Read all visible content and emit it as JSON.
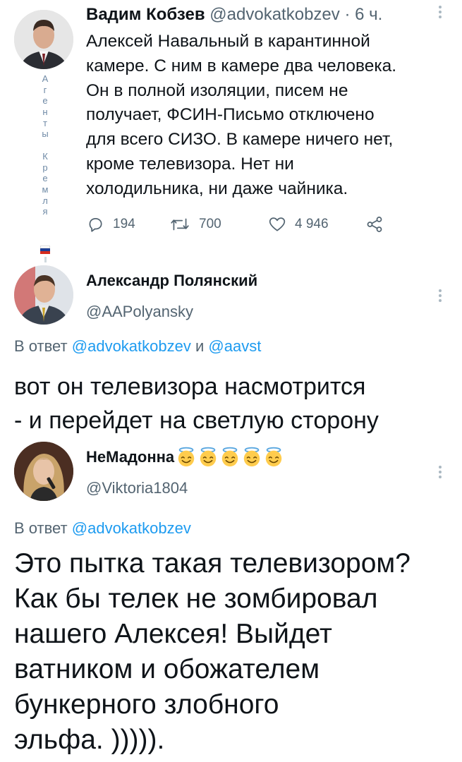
{
  "tweet1": {
    "name": "Вадим Кобзев",
    "handle": "@advokatkobzev",
    "separator": "·",
    "time": "6 ч.",
    "text_lines": [
      "Алексей Навальный в карантинной",
      "камере. С ним в камере два человека.",
      "Он в полной изоляции, писем не",
      "получает, ФСИН-Письмо отключено",
      "для всего СИЗО. В камере ничего нет,",
      "кроме телевизора. Нет ни",
      "холодильника, ни даже чайника."
    ],
    "sidebar_letters": [
      "А",
      "г",
      "е",
      "н",
      "т",
      "ы",
      "",
      "К",
      "р",
      "е",
      "м",
      "л",
      "я"
    ],
    "flag_colors": [
      "#ffffff",
      "#1c3f95",
      "#d52b1e"
    ],
    "reply_count": "194",
    "retweet_count": "700",
    "like_count": "4 946"
  },
  "tweet2": {
    "name": "Александр Полянский",
    "handle": "@AAPolyansky",
    "reply_prefix": "В ответ",
    "reply_to_1": "@advokatkobzev",
    "reply_and": "и",
    "reply_to_2": "@aavst",
    "body_lines": [
      "вот он телевизора насмотрится",
      "- и перейдет на светлую сторону"
    ]
  },
  "tweet3": {
    "name": "НеМадонна",
    "emoji_icon": "smiling-face-with-halo-icon",
    "emoji_count": 5,
    "handle": "@Viktoria1804",
    "reply_prefix": "В ответ",
    "reply_to_1": "@advokatkobzev",
    "body_lines": [
      "Это пытка такая телевизором?",
      "Как бы телек не зомбировал",
      "нашего Алексея! Выйдет",
      "ватником и обожателем",
      "бункерного злобного",
      "эльфа. )))))."
    ]
  },
  "colors": {
    "text": "#0f1419",
    "secondary": "#536471",
    "link": "#1d9bf0"
  }
}
